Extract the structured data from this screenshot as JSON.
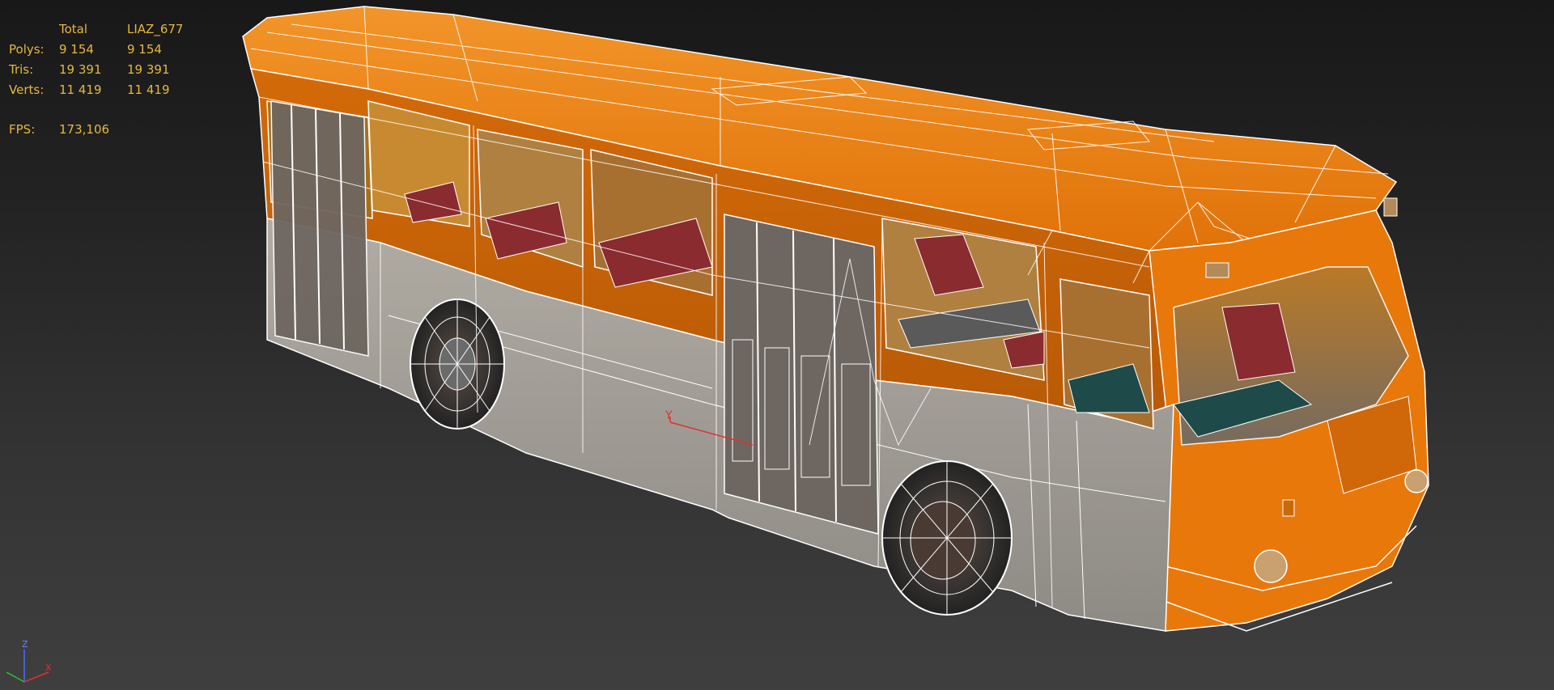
{
  "stats": {
    "header": {
      "c1": "",
      "c2": "Total",
      "c3": "LIAZ_677"
    },
    "polys": {
      "label": "Polys:",
      "total": "9 154",
      "object": "9 154"
    },
    "tris": {
      "label": "Tris:",
      "total": "19 391",
      "object": "19 391"
    },
    "verts": {
      "label": "Verts:",
      "total": "11 419",
      "object": "11 419"
    },
    "fps": {
      "label": "FPS:",
      "value": "173,106"
    }
  },
  "gizmo": {
    "y_label": "Y"
  },
  "axis": {
    "z_label": "Z",
    "x_label": "X"
  },
  "colors": {
    "background_top": "#181818",
    "background_bottom": "#3f3f3f",
    "stats_text": "#e6b840",
    "bus_orange": "#e8780a",
    "bus_body_lower": "#a8a49c",
    "wireframe": "#ffffff",
    "seat_red": "#8a2b30",
    "axis_z": "#4a6cff",
    "axis_x": "#e03030",
    "axis_y": "#30c030"
  }
}
